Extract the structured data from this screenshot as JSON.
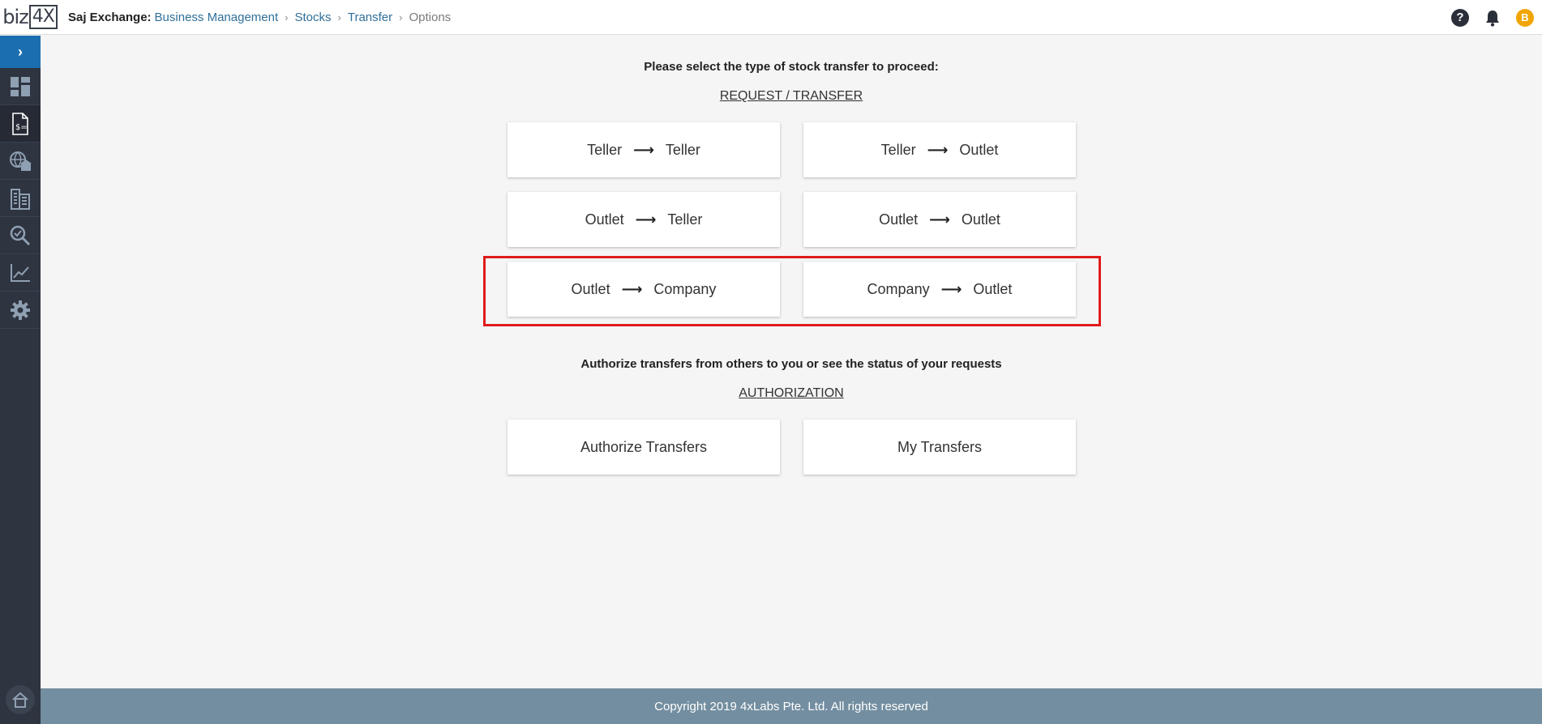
{
  "header": {
    "logo_text": "biz",
    "logo_box_text": "4X",
    "org_name": "Saj Exchange:",
    "breadcrumbs": [
      "Business Management",
      "Stocks",
      "Transfer",
      "Options"
    ],
    "breadcrumb_separator": "›",
    "help_icon": "?",
    "avatar_initial": "B"
  },
  "sidebar": {
    "toggle_icon": "›",
    "items": [
      {
        "icon": "dashboard-icon"
      },
      {
        "icon": "document-dollar-icon",
        "active": true
      },
      {
        "icon": "globe-bank-icon"
      },
      {
        "icon": "building-icon"
      },
      {
        "icon": "search-check-icon"
      },
      {
        "icon": "chart-line-icon"
      },
      {
        "icon": "gear-icon"
      }
    ],
    "bottom_icon": "home-icon"
  },
  "request_section": {
    "prompt": "Please select the type of stock transfer to proceed:",
    "heading": "REQUEST / TRANSFER",
    "arrow": "⟶",
    "options": [
      {
        "from": "Teller",
        "to": "Teller"
      },
      {
        "from": "Teller",
        "to": "Outlet"
      },
      {
        "from": "Outlet",
        "to": "Teller"
      },
      {
        "from": "Outlet",
        "to": "Outlet"
      },
      {
        "from": "Outlet",
        "to": "Company"
      },
      {
        "from": "Company",
        "to": "Outlet"
      }
    ]
  },
  "authorization_section": {
    "prompt": "Authorize transfers from others to you or see the status of your requests",
    "heading": "AUTHORIZATION",
    "buttons": [
      "Authorize Transfers",
      "My Transfers"
    ]
  },
  "footer": {
    "copyright": "Copyright 2019 4xLabs Pte. Ltd. All rights reserved"
  },
  "colors": {
    "sidebar_bg": "#2e3440",
    "sidebar_toggle": "#1b6fb0",
    "footer_bg": "#738ea0",
    "highlight_border": "#e01b1b",
    "avatar": "#f0a500",
    "link": "#2f6f9a"
  }
}
